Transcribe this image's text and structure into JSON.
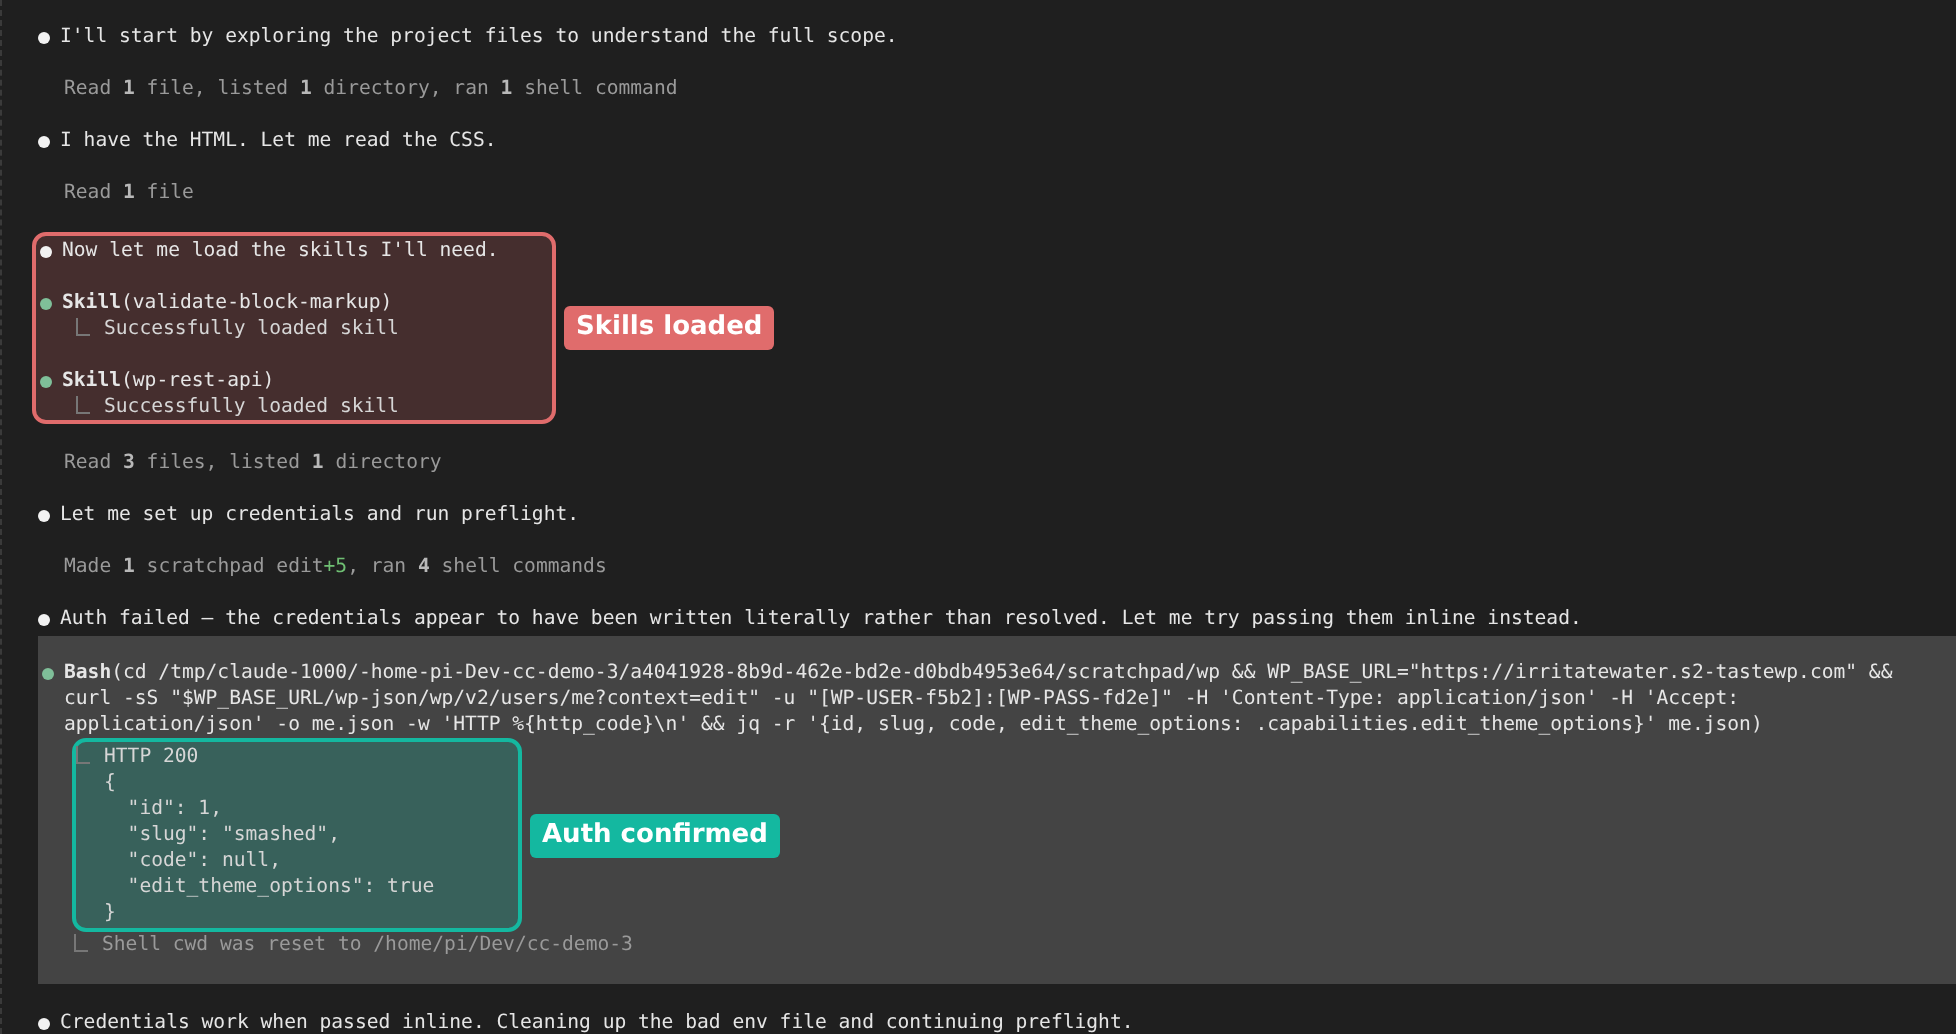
{
  "transcript": [
    {
      "kind": "message",
      "text": "I'll start by exploring the project files to understand the full scope."
    },
    {
      "kind": "summary",
      "text": "Read **1** file, listed **1** directory, ran **1** shell command"
    },
    {
      "kind": "message",
      "text": "I have the HTML. Let me read the CSS."
    },
    {
      "kind": "summary",
      "text": "Read **1** file"
    },
    {
      "kind": "group",
      "label": "Skills loaded",
      "color": "#e06c6c",
      "items": [
        {
          "kind": "message",
          "text": "Now let me load the skills I'll need."
        },
        {
          "kind": "tool",
          "name": "Skill",
          "args": [
            "(validate-block-markup)"
          ],
          "result": [
            "Successfully loaded skill"
          ]
        },
        {
          "kind": "tool",
          "name": "Skill",
          "args": [
            "(wp-rest-api)"
          ],
          "result": [
            "Successfully loaded skill"
          ]
        }
      ]
    },
    {
      "kind": "summary",
      "text": "Read **3** files, listed **1** directory"
    },
    {
      "kind": "message",
      "text": "Let me set up credentials and run preflight."
    },
    {
      "kind": "summary",
      "text": "Made **1** scratchpad edit",
      "added": "+5",
      "rest": ", ran **4** shell commands"
    },
    {
      "kind": "message",
      "text": "Auth failed — the credentials appear to have been written literally rather than resolved. Let me try passing them inline instead."
    },
    {
      "kind": "panel",
      "name": "Bash",
      "args": [
        "(cd /tmp/claude-1000/-home-pi-Dev-cc-demo-3/a4041928-8b9d-462e-bd2e-d0bdb4953e64/scratchpad/wp && WP_BASE_URL=\"https://irritatewater.s2-tastewp.com\" &&",
        "curl -sS \"$WP_BASE_URL/wp-json/wp/v2/users/me?context=edit\" -u \"[WP-USER-f5b2]:[WP-PASS-fd2e]\" -H 'Content-Type: application/json' -H 'Accept:",
        "application/json' -o me.json -w 'HTTP %{http_code}\\n' && jq -r '{id, slug, code, edit_theme_options: .capabilities.edit_theme_options}' me.json)"
      ],
      "result": [
        "HTTP 200",
        "{",
        "  \"id\": 1,",
        "  \"slug\": \"smashed\",",
        "  \"code\": null,",
        "  \"edit_theme_options\": true",
        "}"
      ],
      "note": "Shell cwd was reset to /home/pi/Dev/cc-demo-3",
      "label": "Auth confirmed",
      "color": "#14b8a0"
    },
    {
      "kind": "message",
      "text": "Credentials work when passed inline. Cleaning up the bad env file and continuing preflight."
    }
  ]
}
